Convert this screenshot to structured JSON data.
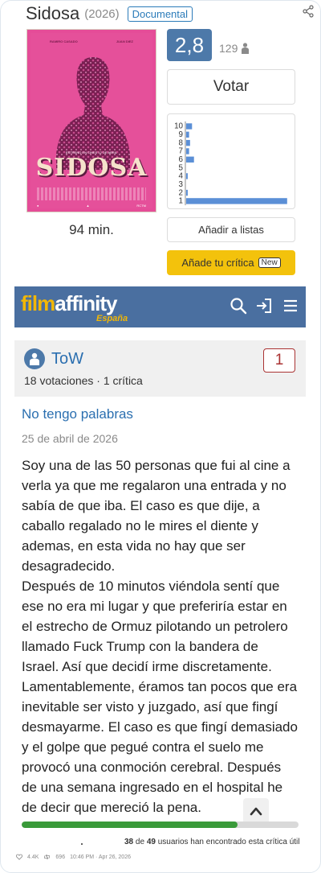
{
  "movie": {
    "title": "Sidosa",
    "year": "(2026)",
    "genre": "Documental",
    "duration": "94 min.",
    "poster": {
      "title": "SIDOSA",
      "actor_left": "RAMIRO CASADO",
      "actor_right": "JUAN DIEZ",
      "tagline": "ESTRENO EN CINES 12 DE ABRIL",
      "logo_right": "RCTM"
    }
  },
  "rating": {
    "average": "2,8",
    "votes": "129",
    "vote_button": "Votar",
    "add_to_lists": "Añadir a listas",
    "add_review": "Añade tu crítica",
    "new_badge": "New"
  },
  "chart_data": {
    "type": "bar",
    "orientation": "horizontal",
    "categories": [
      "10",
      "9",
      "8",
      "7",
      "6",
      "5",
      "4",
      "3",
      "2",
      "1"
    ],
    "values": [
      6,
      3,
      4,
      3,
      8,
      0,
      1,
      0,
      1,
      103
    ],
    "bar_color": "#5b8fd6"
  },
  "banner": {
    "logo_part1": "film",
    "logo_part2": "affinity",
    "country": "España"
  },
  "review": {
    "user": "ToW",
    "user_stats": "18 votaciones · 1 crítica",
    "score": "1",
    "title": "No tengo palabras",
    "date": "25 de abril de 2026",
    "paragraph1": "Soy una de las 50 personas que fui al cine a verla ya que me regalaron una entrada y no sabía de que iba. El caso es que dije, a caballo regalado no le mires el diente y ademas, en esta vida no hay que ser desagradecido.",
    "paragraph2": "Después de 10 minutos viéndola sentí que ese no era mi lugar y que preferiría estar en el estrecho de Ormuz pilotando un petrolero llamado Fuck Trump con la bandera de Israel. Así que decidí irme discretamente. Lamentablemente, éramos tan pocos que era inevitable ser visto y juzgado, así que fingí desmayarme. El caso es que fingí demasiado y el golpe que pegué contra el suelo me provocó una conmoción cerebral. Después de una semana ingresado en el hospital he de decir que mereció la pena.",
    "useful_count": "38",
    "useful_of": "de",
    "useful_total": "49",
    "useful_text": "usuarios han encontrado esta crítica útil",
    "useful_fraction": 0.78
  },
  "footer": {
    "likes": "4.4K",
    "reposts": "696",
    "timestamp": "10:46 PM · Apr 26, 2026"
  }
}
